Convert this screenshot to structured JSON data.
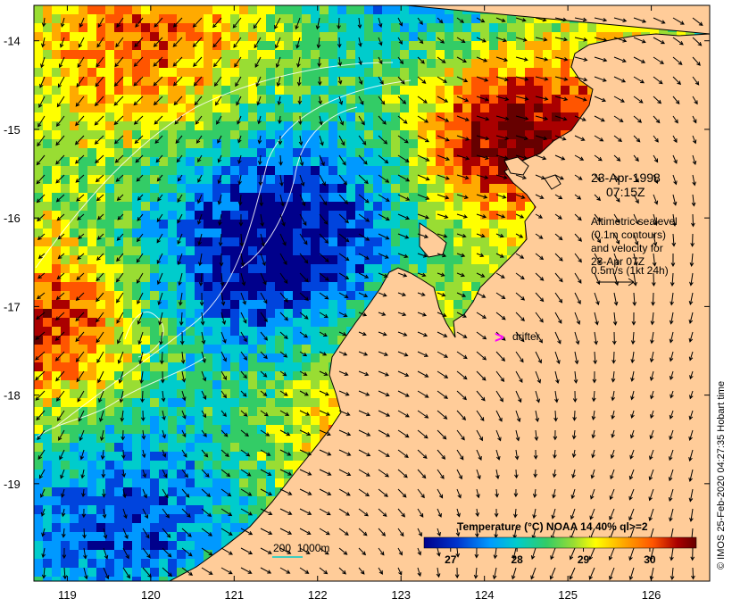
{
  "map": {
    "lon_ticks": [
      "119",
      "120",
      "121",
      "122",
      "123",
      "124",
      "125",
      "126"
    ],
    "lat_ticks": [
      "-14",
      "-15",
      "-16",
      "-17",
      "-18",
      "-19"
    ],
    "lon_range": [
      118.6,
      126.7
    ],
    "lat_range": [
      -20.1,
      -13.6
    ]
  },
  "annotations": {
    "date": "23-Apr-1998",
    "time": "07:15Z",
    "legend_lines": [
      "Altimetric sealevel",
      "(0.1m contours)",
      "and velocity for",
      "23-Apr 07Z",
      "0.5m/s (1kt 24h)"
    ],
    "drifter_label": "drifter",
    "drifter_marker": ">",
    "depth_contours": "200  1000m"
  },
  "colorbar": {
    "title": "Temperature (°C) NOAA 14 40% ql>=2",
    "ticks": [
      "27",
      "28",
      "29",
      "30"
    ],
    "range": [
      26.6,
      30.7
    ]
  },
  "credit": "© IMOS 25-Feb-2020 04:27:35 Hobart time",
  "colors": {
    "land": "#ffcc99",
    "drifter": "#ff00ff",
    "contour": "#ffffff",
    "depth_contour": "#00cccc",
    "sst_scale": [
      "#00008b",
      "#0044dd",
      "#0099ff",
      "#00cccc",
      "#33cc66",
      "#99dd33",
      "#ffff00",
      "#ffaa00",
      "#ff5500",
      "#aa0000",
      "#660000"
    ]
  }
}
